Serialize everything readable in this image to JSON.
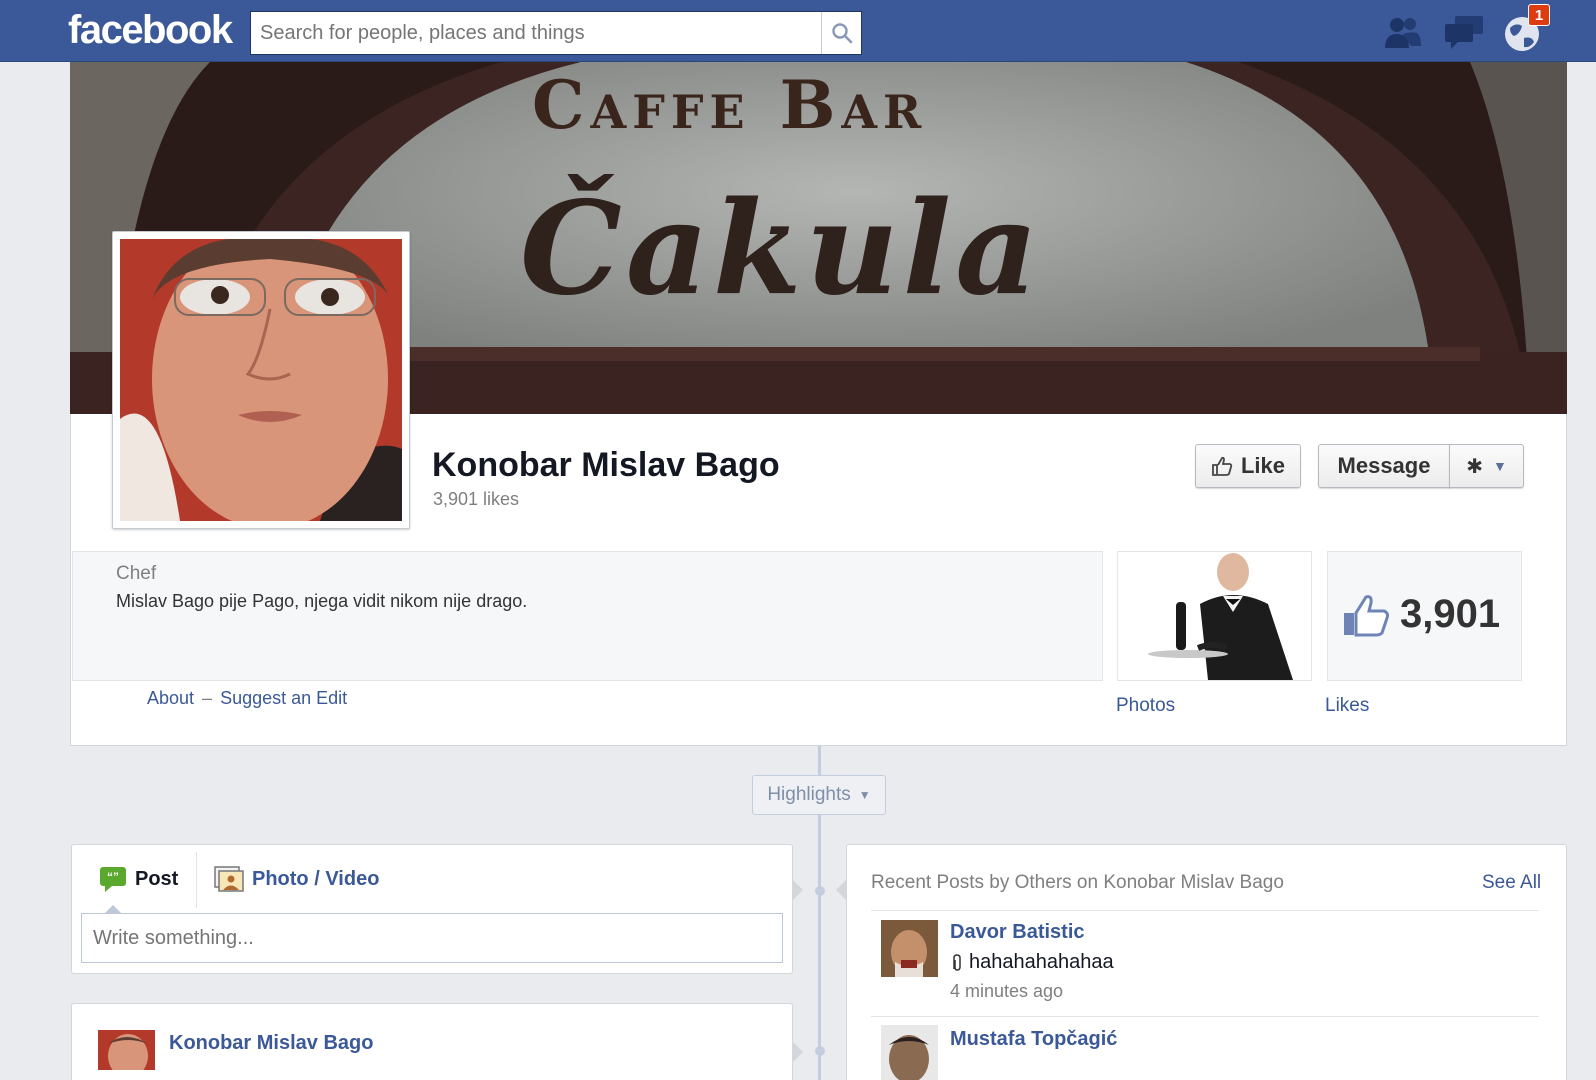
{
  "header": {
    "logo": "facebook",
    "search_placeholder": "Search for people, places and things",
    "notifications_count": "1"
  },
  "cover": {
    "line1": "Caffe Bar",
    "line2": "Čakula"
  },
  "profile": {
    "name": "Konobar Mislav Bago",
    "likes_text": "3,901 likes",
    "like_label": "Like",
    "message_label": "Message",
    "category": "Chef",
    "description": "Mislav Bago pije Pago, njega vidit nikom nije drago.",
    "about_link": "About",
    "separator": "–",
    "suggest_link": "Suggest an Edit",
    "photos_label": "Photos",
    "likes_label": "Likes",
    "likes_count": "3,901"
  },
  "timeline": {
    "highlights_label": "Highlights"
  },
  "composer": {
    "post_tab": "Post",
    "photo_tab": "Photo / Video",
    "placeholder": "Write something..."
  },
  "feed_post": {
    "author": "Konobar Mislav Bago"
  },
  "recent_posts": {
    "title": "Recent Posts by Others on Konobar Mislav Bago",
    "see_all": "See All",
    "items": [
      {
        "author": "Davor Batistic",
        "text": "hahahahahahaa",
        "time": "4 minutes ago"
      },
      {
        "author": "Mustafa Topčagić"
      }
    ]
  },
  "colors": {
    "brand": "#3b5998",
    "background": "#e9ebee",
    "badge": "#dd3c10"
  }
}
